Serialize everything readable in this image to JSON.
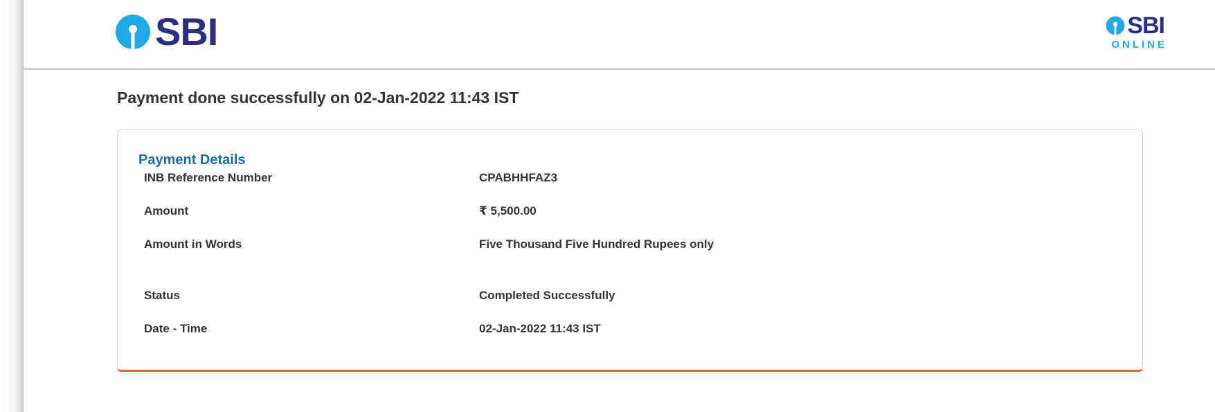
{
  "header": {
    "logo_text": "SBI",
    "secondary_logo_text": "SBI",
    "secondary_logo_tagline": "ONLINE",
    "brand_color": "#2b2e83",
    "accent_color": "#1fa9e0"
  },
  "title": "Payment done successfully on 02-Jan-2022 11:43 IST",
  "card": {
    "title": "Payment Details",
    "accent_border_color": "#e8652f",
    "rows": [
      {
        "label": "INB Reference Number",
        "value": "CPABHHFAZ3"
      },
      {
        "label": "Amount",
        "value": "₹ 5,500.00"
      },
      {
        "label": "Amount in Words",
        "value": "Five Thousand Five Hundred Rupees only"
      },
      {
        "label": "Status",
        "value": "Completed Successfully"
      },
      {
        "label": "Date - Time",
        "value": "02-Jan-2022 11:43 IST"
      }
    ]
  }
}
